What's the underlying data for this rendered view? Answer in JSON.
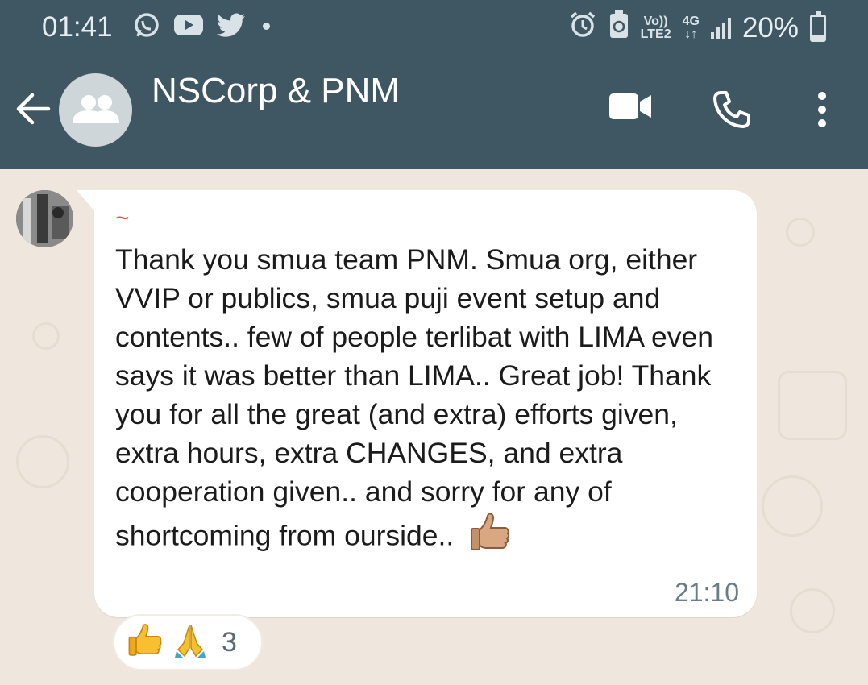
{
  "status_bar": {
    "time": "01:41",
    "network_top": "Vo))",
    "network_bottom": "LTE2",
    "network_type": "4G",
    "battery": "20%",
    "battery_level": 0.2,
    "icons": [
      "whatsapp-icon",
      "youtube-icon",
      "twitter-icon",
      "alarm-icon",
      "battery-saver-icon",
      "signal-icon",
      "battery-icon"
    ]
  },
  "header": {
    "title": "NSCorp & PNM",
    "icons": [
      "back-arrow-icon",
      "group-avatar-icon",
      "video-call-icon",
      "phone-call-icon",
      "more-options-icon"
    ]
  },
  "message": {
    "sender_name": "~",
    "text": "Thank you smua team PNM. Smua org, either VVIP or publics, smua puji event setup and contents.. few of people terlibat with LIMA even says it was better than LIMA.. Great job! Thank you for all the great (and extra) efforts given, extra hours, extra CHANGES, and extra cooperation given.. and sorry for any of shortcoming from ourside..",
    "emoji": "thumbs-up-icon",
    "time": "21:10"
  },
  "reactions": {
    "emojis": [
      "thumbs-up-icon",
      "folded-hands-icon"
    ],
    "count": "3"
  },
  "colors": {
    "header_bg": "#3e5763",
    "chat_bg": "#efe7dd",
    "bubble_bg": "#ffffff",
    "sender_name": "#e8582a",
    "timestamp": "#6b7c85"
  }
}
